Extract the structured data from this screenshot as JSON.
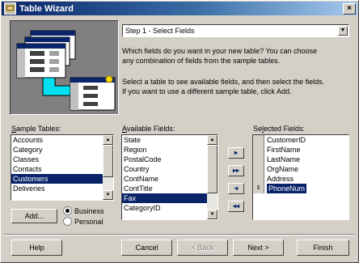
{
  "window": {
    "title": "Table Wizard",
    "close_glyph": "×"
  },
  "art": {
    "rows_back": [
      "1 vvv ww",
      "2 xxx xxx",
      "3 xxx xxx"
    ],
    "rows_front": [
      "1 xxx ww",
      "2 xxx ww",
      "3 xxx ww"
    ],
    "accent": "#00e0f0"
  },
  "step_combo": {
    "value": "Step 1 - Select Fields",
    "arrow": "▼"
  },
  "description": {
    "line1": "Which fields do you want in your new table? You can choose",
    "line2": "any combination of fields from the sample tables.",
    "line3": "Select a table to see available fields, and then select the fields.",
    "line4": "If you want to use a different sample table, click Add."
  },
  "sample_tables": {
    "label_pre": "S",
    "label_rest": "ample Tables:",
    "items": [
      "Accounts",
      "Category",
      "Classes",
      "Contacts",
      "Customers",
      "Deliveries"
    ],
    "selected": "Customers"
  },
  "available_fields": {
    "label_pre": "A",
    "label_rest": "vailable Fields:",
    "items": [
      "State",
      "Region",
      "PostalCode",
      "Country",
      "ContName",
      "ContTitle",
      "Fax",
      "CategoryID"
    ],
    "selected": "Fax"
  },
  "selected_fields": {
    "label_pre": "Se",
    "label_u": "l",
    "label_rest": "ected Fields:",
    "items": [
      "CustomerID",
      "FirstName",
      "LastName",
      "OrgName",
      "Address",
      "PhoneNum"
    ],
    "selected": "PhoneNum",
    "selected_mark": "⇕"
  },
  "move_buttons": {
    "add_one": "▸",
    "add_all": "▸▸",
    "remove_one": "◂",
    "remove_all": "◂◂"
  },
  "add_button": "Add...",
  "table_type": {
    "business": "Business",
    "personal": "Personal",
    "selected": "Business"
  },
  "footer": {
    "help": "Help",
    "cancel": "Cancel",
    "back": "< Back",
    "next": "Next >",
    "finish": "Finish"
  }
}
